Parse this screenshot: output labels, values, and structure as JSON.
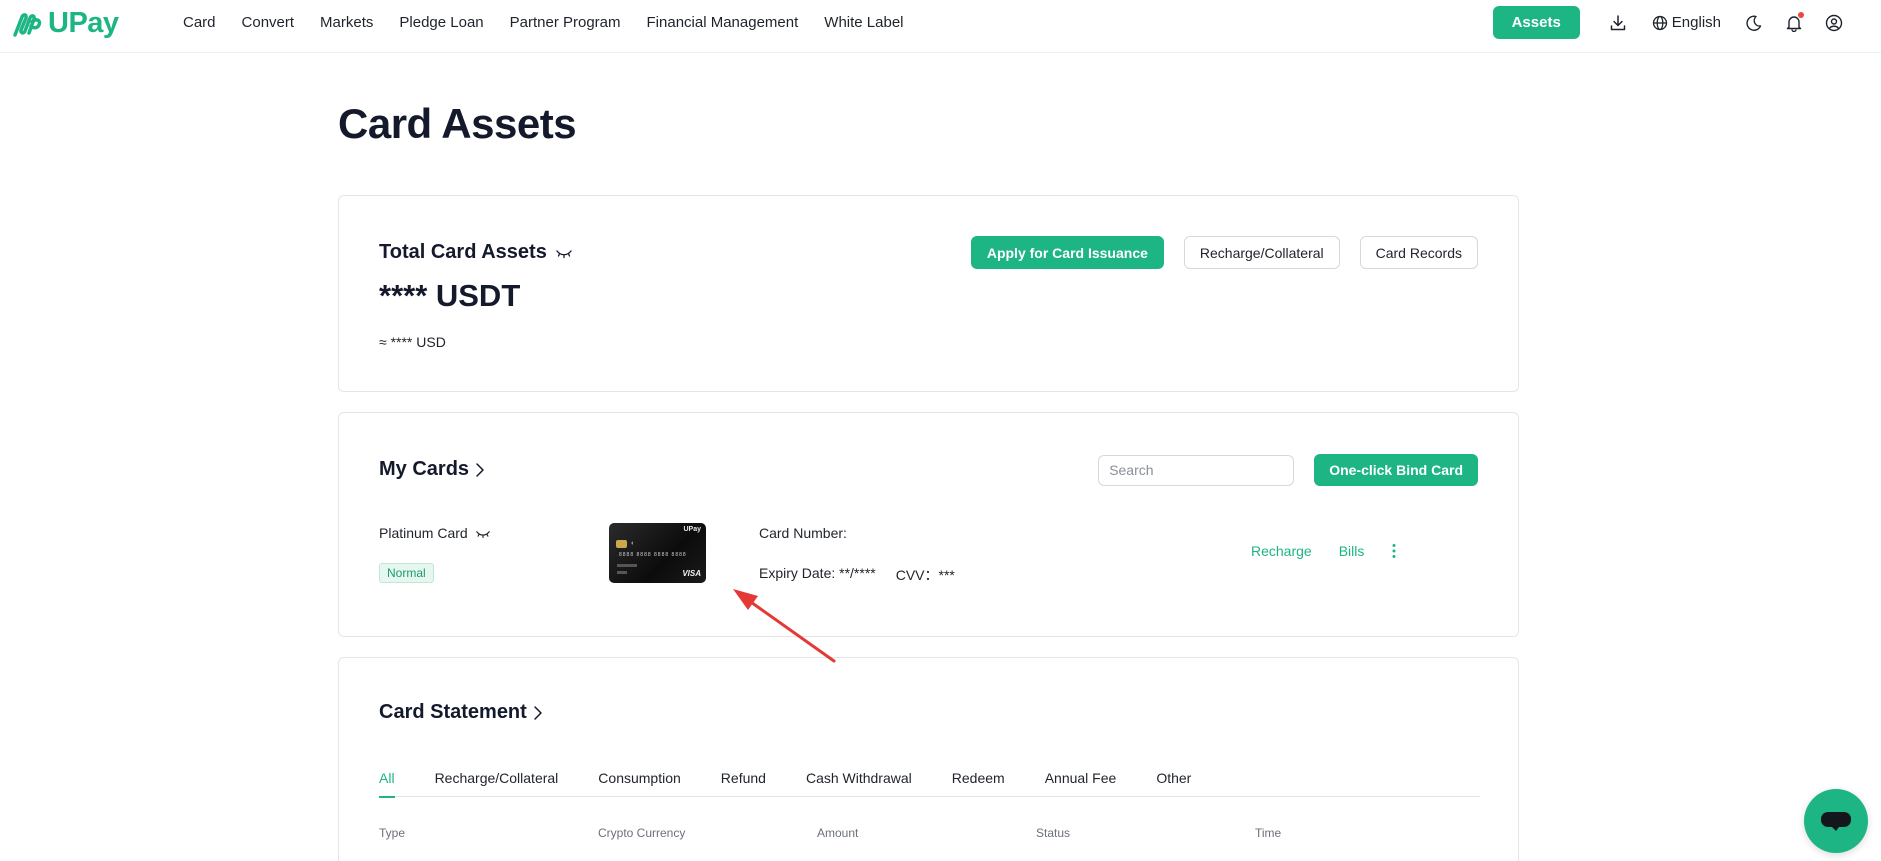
{
  "header": {
    "brand": "UPay",
    "nav": [
      "Card",
      "Convert",
      "Markets",
      "Pledge Loan",
      "Partner Program",
      "Financial Management",
      "White Label"
    ],
    "assets_button": "Assets",
    "language": "English",
    "icons": [
      "download-icon",
      "globe-icon",
      "moon-icon",
      "bell-icon",
      "user-icon"
    ]
  },
  "page": {
    "title": "Card Assets"
  },
  "total_assets": {
    "title": "Total Card Assets",
    "amount": "**** USDT",
    "approx": "≈ **** USD",
    "buttons": {
      "apply": "Apply for Card Issuance",
      "recharge": "Recharge/Collateral",
      "records": "Card Records"
    }
  },
  "my_cards": {
    "title": "My Cards",
    "search_placeholder": "Search",
    "bind_button": "One-click Bind Card",
    "card": {
      "name": "Platinum Card",
      "status": "Normal",
      "image_brand": "UPay",
      "image_number": "8888 8888 8888 8888",
      "image_network": "VISA",
      "number_label": "Card Number:",
      "expiry": "Expiry Date: **/****",
      "cvv": "CVV：***",
      "actions": {
        "recharge": "Recharge",
        "bills": "Bills"
      }
    }
  },
  "statement": {
    "title": "Card Statement",
    "tabs": [
      "All",
      "Recharge/Collateral",
      "Consumption",
      "Refund",
      "Cash Withdrawal",
      "Redeem",
      "Annual Fee",
      "Other"
    ],
    "active_tab": "All",
    "columns": [
      "Type",
      "Crypto Currency",
      "Amount",
      "Status",
      "Time"
    ]
  },
  "colors": {
    "accent": "#1db584",
    "annotation_arrow": "#e53935"
  }
}
